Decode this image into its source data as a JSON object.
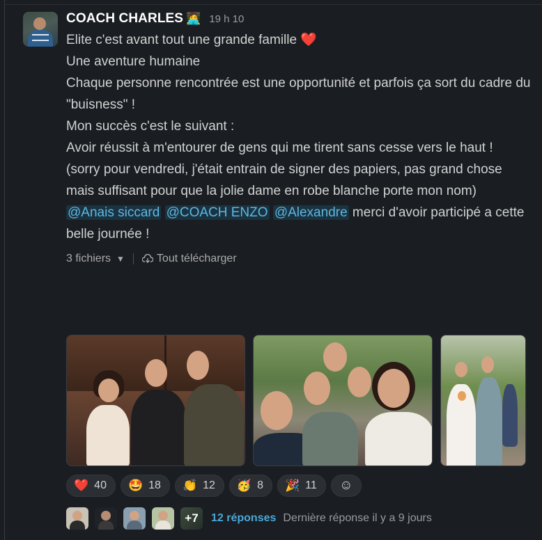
{
  "message": {
    "author": "COACH CHARLES",
    "author_emoji": "🧑‍💻",
    "timestamp": "19 h 10",
    "line1": "Elite c'est avant tout une grande famille ",
    "line1_emoji": "❤️",
    "p2_l1": "Une aventure humaine",
    "p2_l2": "Chaque personne rencontrée est une opportunité et parfois ça sort du cadre du \"buisness\" !",
    "p3": "Mon succès c'est le suivant :",
    "p4": "Avoir réussit à m'entourer de gens qui me tirent sans cesse vers le haut !",
    "p5": "(sorry pour vendredi, j'était entrain de signer des papiers, pas grand chose mais suffisant pour que la jolie dame en robe blanche porte mon nom)",
    "mentions": [
      "@Anais siccard",
      "@COACH ENZO",
      "@Alexandre"
    ],
    "p6_tail": " merci d'avoir participé a cette belle journée !"
  },
  "files": {
    "count_label": "3 fichiers",
    "caret": "▼",
    "download_all": "Tout télécharger"
  },
  "reactions": [
    {
      "emoji": "❤️",
      "count": "40"
    },
    {
      "emoji": "🤩",
      "count": "18"
    },
    {
      "emoji": "👏",
      "count": "12"
    },
    {
      "emoji": "🥳",
      "count": "8"
    },
    {
      "emoji": "🎉",
      "count": "11"
    }
  ],
  "add_reaction_icon": "☺",
  "thread": {
    "more": "+7",
    "replies": "12 réponses",
    "last_reply": "Dernière réponse il y a 9 jours"
  }
}
